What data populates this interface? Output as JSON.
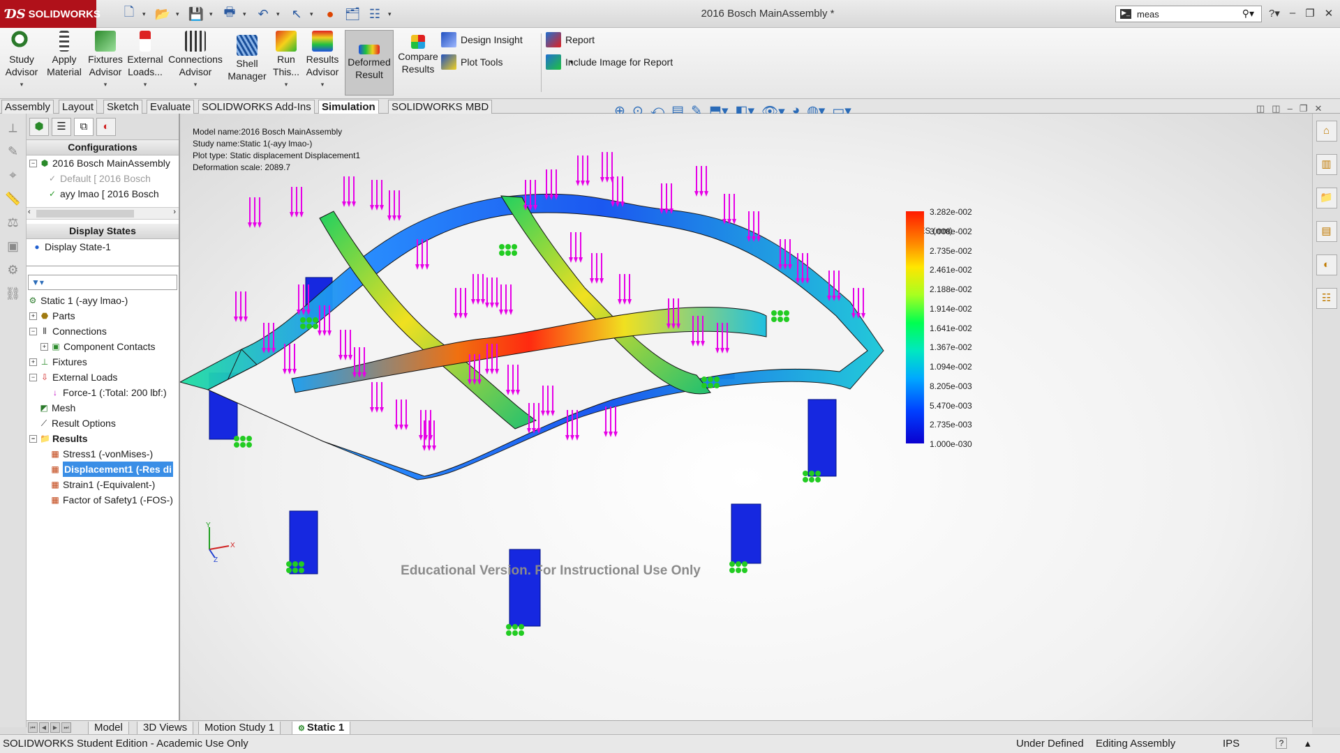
{
  "app": {
    "logo_text": "SOLIDWORKS",
    "document_title": "2016 Bosch MainAssembly *"
  },
  "search": {
    "value": "meas"
  },
  "ribbon": {
    "study_advisor": "Study Advisor",
    "apply_material": "Apply Material",
    "fixtures_advisor": "Fixtures Advisor",
    "external_loads": "External Loads...",
    "connections_advisor": "Connections Advisor",
    "shell_manager": "Shell Manager",
    "run_this": "Run This...",
    "results_advisor": "Results Advisor",
    "deformed_result": "Deformed Result",
    "compare_results": "Compare Results",
    "design_insight": "Design Insight",
    "plot_tools": "Plot Tools",
    "report": "Report",
    "include_image": "Include Image for Report"
  },
  "command_tabs": [
    "Assembly",
    "Layout",
    "Sketch",
    "Evaluate",
    "SOLIDWORKS Add-Ins",
    "Simulation",
    "SOLIDWORKS MBD"
  ],
  "active_command_tab": "Simulation",
  "configurations": {
    "header": "Configurations",
    "root": "2016 Bosch MainAssembly",
    "items": [
      "Default [ 2016 Bosch",
      "ayy lmao [ 2016 Bosch"
    ]
  },
  "display_states": {
    "header": "Display States",
    "items": [
      "Display State-1"
    ]
  },
  "study_tree": {
    "study": "Static 1 (-ayy lmao-)",
    "parts": "Parts",
    "connections": "Connections",
    "component_contacts": "Component Contacts",
    "fixtures": "Fixtures",
    "external_loads": "External Loads",
    "force": "Force-1 (:Total: 200 lbf:)",
    "mesh": "Mesh",
    "result_options": "Result Options",
    "results": "Results",
    "result_items": [
      "Stress1 (-vonMises-)",
      "Displacement1 (-Res di",
      "Strain1 (-Equivalent-)",
      "Factor of Safety1 (-FOS-)"
    ]
  },
  "plot_info": {
    "model_name": "Model name:2016 Bosch MainAssembly",
    "study_name": "Study name:Static 1(-ayy lmao-)",
    "plot_type": "Plot type: Static displacement Displacement1",
    "deformation_scale": "Deformation scale: 2089.7"
  },
  "legend": {
    "title": "URES (mm)",
    "labels": [
      "3.282e-002",
      "3.008e-002",
      "2.735e-002",
      "2.461e-002",
      "2.188e-002",
      "1.914e-002",
      "1.641e-002",
      "1.367e-002",
      "1.094e-002",
      "8.205e-003",
      "5.470e-003",
      "2.735e-003",
      "1.000e-030"
    ]
  },
  "triad": {
    "x": "X",
    "y": "Y",
    "z": "Z"
  },
  "watermark": "Educational Version. For Instructional Use Only",
  "bottom_tabs": [
    "Model",
    "3D Views",
    "Motion Study 1",
    "Static 1"
  ],
  "active_bottom_tab": "Static 1",
  "status": {
    "edition": "SOLIDWORKS Student Edition - Academic Use Only",
    "definition": "Under Defined",
    "mode": "Editing Assembly",
    "units": "IPS",
    "help": "?"
  },
  "colors": {
    "logo_red": "#b0111a",
    "selection_blue": "#3a8ee6",
    "load_arrow": "#e600e6",
    "fixture_green": "#22cc22"
  }
}
